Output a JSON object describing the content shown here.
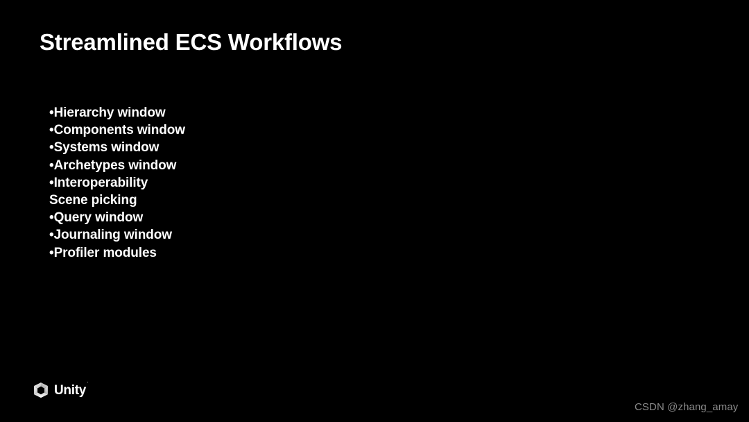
{
  "slide": {
    "background_color": "#000000",
    "title": "Streamlined ECS Workflows",
    "title_color": "#ffffff",
    "body_color": "#ffffff",
    "bullet_char": "•",
    "lines": [
      {
        "bullet": "•",
        "text": "Hierarchy window"
      },
      {
        "bullet": "•",
        "text": "Components window"
      },
      {
        "bullet": "•",
        "text": "Systems window"
      },
      {
        "bullet": "•",
        "text": "Archetypes window"
      },
      {
        "bullet": "•",
        "text": "Interoperability"
      },
      {
        "bullet": "",
        "text": "Scene picking"
      },
      {
        "bullet": "•",
        "text": "Query window"
      },
      {
        "bullet": "•",
        "text": "Journaling window"
      },
      {
        "bullet": "•",
        "text": "Profiler modules"
      }
    ]
  },
  "logo": {
    "icon_name": "unity-cube-icon",
    "wordmark": "Unity",
    "trademark": "˙",
    "color": "#ffffff"
  },
  "watermark": {
    "text": "CSDN @zhang_amay",
    "color": "#8a8a8a"
  }
}
